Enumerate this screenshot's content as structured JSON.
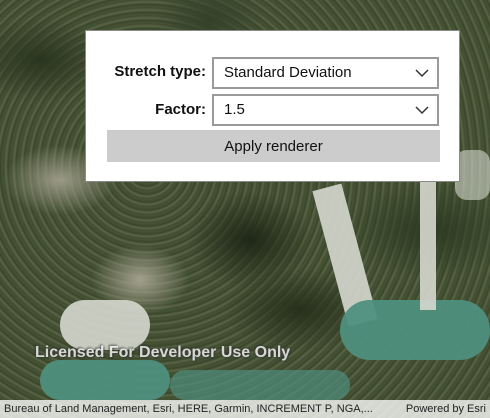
{
  "panel": {
    "stretch_type_label": "Stretch type:",
    "stretch_type_value": "Standard Deviation",
    "factor_label": "Factor:",
    "factor_value": "1.5",
    "apply_label": "Apply renderer"
  },
  "map": {
    "watermark": "Licensed For Developer Use Only",
    "attribution": "Bureau of Land Management, Esri, HERE, Garmin, INCREMENT P, NGA,...",
    "powered_by": "Powered by Esri"
  },
  "icons": {
    "dropdown": "chevron-down-icon"
  }
}
